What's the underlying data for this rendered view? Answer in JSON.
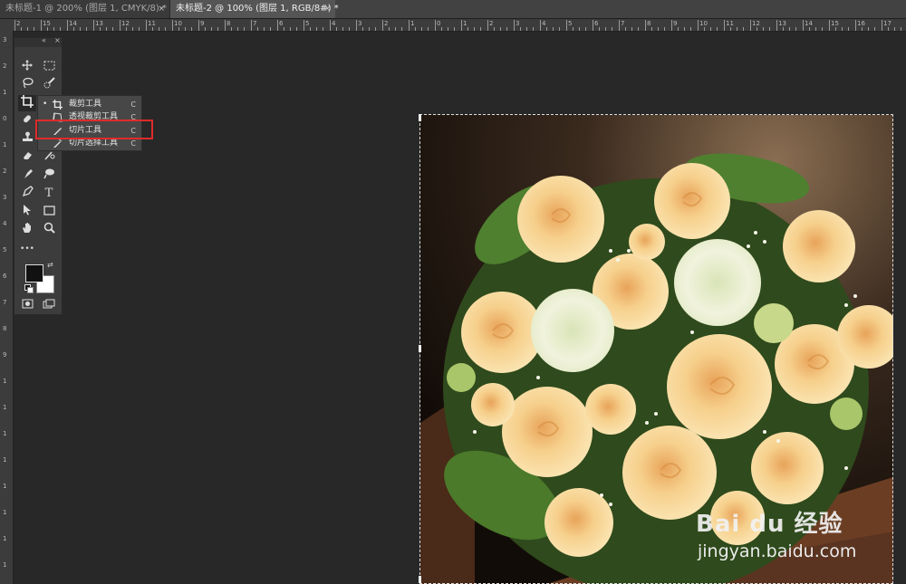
{
  "tabs": [
    {
      "label": "未标题-1 @ 200% (图层 1, CMYK/8) *",
      "close": "×"
    },
    {
      "label": "未标题-2 @ 100% (图层 1, RGB/8#) *",
      "close": "×"
    }
  ],
  "ruler": {
    "h_labels": [
      "2",
      "15",
      "14",
      "13",
      "12",
      "11",
      "10",
      "9",
      "8",
      "7",
      "6",
      "5",
      "4",
      "3",
      "2",
      "1",
      "0",
      "1",
      "2",
      "3",
      "4",
      "5",
      "6",
      "7",
      "8",
      "9",
      "10",
      "11",
      "12",
      "13",
      "14",
      "15",
      "16",
      "17"
    ],
    "v_labels": [
      "3",
      "2",
      "1",
      "0",
      "1",
      "2",
      "3",
      "4",
      "5",
      "6",
      "7",
      "8",
      "9",
      "1",
      "1",
      "1",
      "1",
      "1",
      "1",
      "1",
      "1"
    ]
  },
  "toolbar": {
    "collapse_label": "«",
    "close_label": "×",
    "more_label": "•••"
  },
  "flyout": {
    "items": [
      {
        "icon": "crop-icon",
        "label": "裁剪工具",
        "key": "C",
        "active": true
      },
      {
        "icon": "perspective-crop-icon",
        "label": "透视裁剪工具",
        "key": "C"
      },
      {
        "icon": "slice-icon",
        "label": "切片工具",
        "key": "C"
      },
      {
        "icon": "slice-select-icon",
        "label": "切片选择工具",
        "key": "C"
      }
    ]
  },
  "watermark": {
    "logo": "Bai du 经验",
    "url": "jingyan.baidu.com"
  },
  "colors": {
    "highlight_border": "#e02b2b",
    "foreground_swatch": "#111111",
    "background_swatch": "#ffffff"
  }
}
